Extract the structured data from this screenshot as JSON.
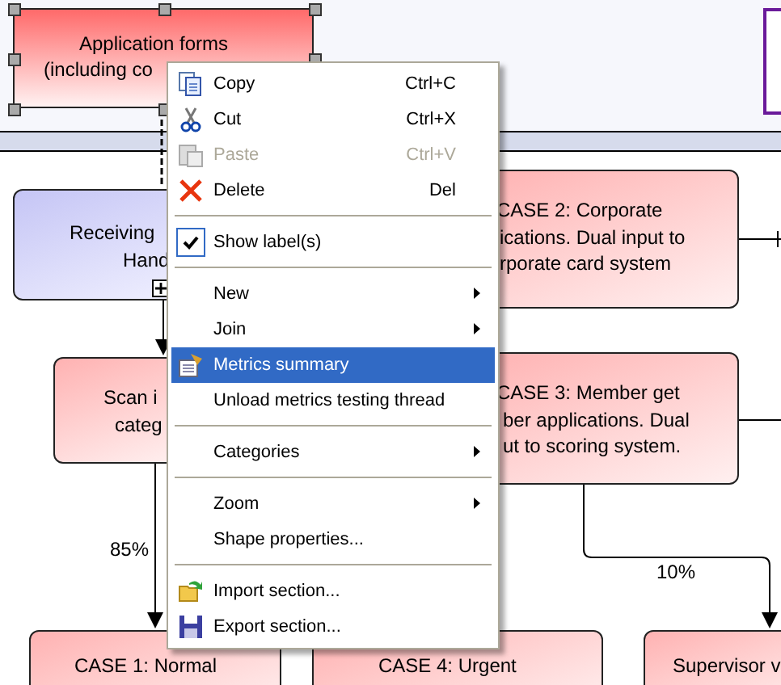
{
  "nodes": [
    {
      "kind": "process",
      "selected": true,
      "expandable": false,
      "lines": [
        "Application forms",
        "(including co"
      ]
    },
    {
      "kind": "note",
      "selected": false,
      "expandable": false
    },
    {
      "kind": "subprocess",
      "selected": false,
      "expandable": true,
      "lines": [
        "Receiving",
        "Hand"
      ]
    },
    {
      "kind": "process",
      "selected": false,
      "expandable": false,
      "lines": [
        "Scan i",
        "categ"
      ]
    },
    {
      "kind": "process",
      "selected": false,
      "expandable": false,
      "lines": [
        "CASE 2: Corporate",
        "ications.  Dual input to",
        "rporate card system"
      ]
    },
    {
      "kind": "process",
      "selected": false,
      "expandable": false,
      "lines": [
        "CASE 3: Member get",
        "ber applications. Dual",
        "ut to scoring system."
      ]
    },
    {
      "kind": "process",
      "selected": false,
      "expandable": false,
      "lines": [
        "CASE 1: Normal"
      ]
    },
    {
      "kind": "process",
      "selected": false,
      "expandable": false,
      "lines": [
        "CASE 4: Urgent"
      ]
    },
    {
      "kind": "process",
      "selected": false,
      "expandable": false,
      "lines": [
        "Supervisor v"
      ]
    }
  ],
  "edge_labels": [
    "85%",
    "10%"
  ],
  "context_menu": [
    {
      "kind": "item",
      "label": "Copy",
      "shortcut": "Ctrl+C",
      "disabled": false,
      "checked": false,
      "submenu": false,
      "selected": false
    },
    {
      "kind": "item",
      "label": "Cut",
      "shortcut": "Ctrl+X",
      "disabled": false,
      "checked": false,
      "submenu": false,
      "selected": false
    },
    {
      "kind": "item",
      "label": "Paste",
      "shortcut": "Ctrl+V",
      "disabled": true,
      "checked": false,
      "submenu": false,
      "selected": false
    },
    {
      "kind": "item",
      "label": "Delete",
      "shortcut": "Del",
      "disabled": false,
      "checked": false,
      "submenu": false,
      "selected": false
    },
    {
      "kind": "separator"
    },
    {
      "kind": "item",
      "label": "Show label(s)",
      "disabled": false,
      "checked": true,
      "submenu": false,
      "selected": false
    },
    {
      "kind": "separator"
    },
    {
      "kind": "item",
      "label": "New",
      "disabled": false,
      "checked": false,
      "submenu": true,
      "selected": false
    },
    {
      "kind": "item",
      "label": "Join",
      "disabled": false,
      "checked": false,
      "submenu": true,
      "selected": false
    },
    {
      "kind": "item",
      "label": "Metrics summary",
      "disabled": false,
      "checked": false,
      "submenu": false,
      "selected": true
    },
    {
      "kind": "item",
      "label": "Unload metrics testing thread",
      "disabled": false,
      "checked": false,
      "submenu": false,
      "selected": false
    },
    {
      "kind": "separator"
    },
    {
      "kind": "item",
      "label": "Categories",
      "disabled": false,
      "checked": false,
      "submenu": true,
      "selected": false
    },
    {
      "kind": "separator"
    },
    {
      "kind": "item",
      "label": "Zoom",
      "disabled": false,
      "checked": false,
      "submenu": true,
      "selected": false
    },
    {
      "kind": "item",
      "label": "Shape properties...",
      "disabled": false,
      "checked": false,
      "submenu": false,
      "selected": false
    },
    {
      "kind": "separator"
    },
    {
      "kind": "item",
      "label": "Import section...",
      "disabled": false,
      "checked": false,
      "submenu": false,
      "selected": false
    },
    {
      "kind": "item",
      "label": "Export section...",
      "disabled": false,
      "checked": false,
      "submenu": false,
      "selected": false
    }
  ]
}
